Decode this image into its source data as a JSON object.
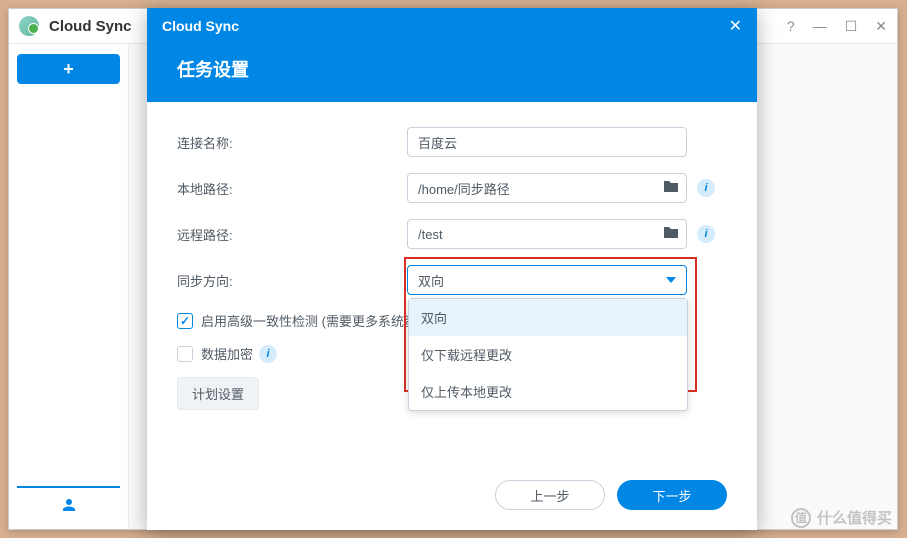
{
  "app": {
    "title": "Cloud Sync",
    "titlebar": {
      "help": "?",
      "min": "—",
      "max": "☐",
      "close": "✕"
    }
  },
  "sidebar": {
    "add_label": "+"
  },
  "modal": {
    "titlebar": "Cloud Sync",
    "close": "✕",
    "header": "任务设置",
    "form": {
      "connection_name": {
        "label": "连接名称:",
        "value": "百度云"
      },
      "local_path": {
        "label": "本地路径:",
        "value": "/home/同步路径"
      },
      "remote_path": {
        "label": "远程路径:",
        "value": "/test"
      },
      "sync_direction": {
        "label": "同步方向:",
        "selected": "双向",
        "options": [
          "双向",
          "仅下载远程更改",
          "仅上传本地更改"
        ]
      },
      "advanced_check": {
        "label": "启用高级一致性检测 (需要更多系统资源)。",
        "checked": true
      },
      "encryption": {
        "label": "数据加密",
        "checked": false
      },
      "schedule": "计划设置"
    },
    "footer": {
      "back": "上一步",
      "next": "下一步"
    }
  },
  "watermark": "什么值得买",
  "icons": {
    "info": "i",
    "check": "✓",
    "user": "👤",
    "thumb": "值"
  }
}
